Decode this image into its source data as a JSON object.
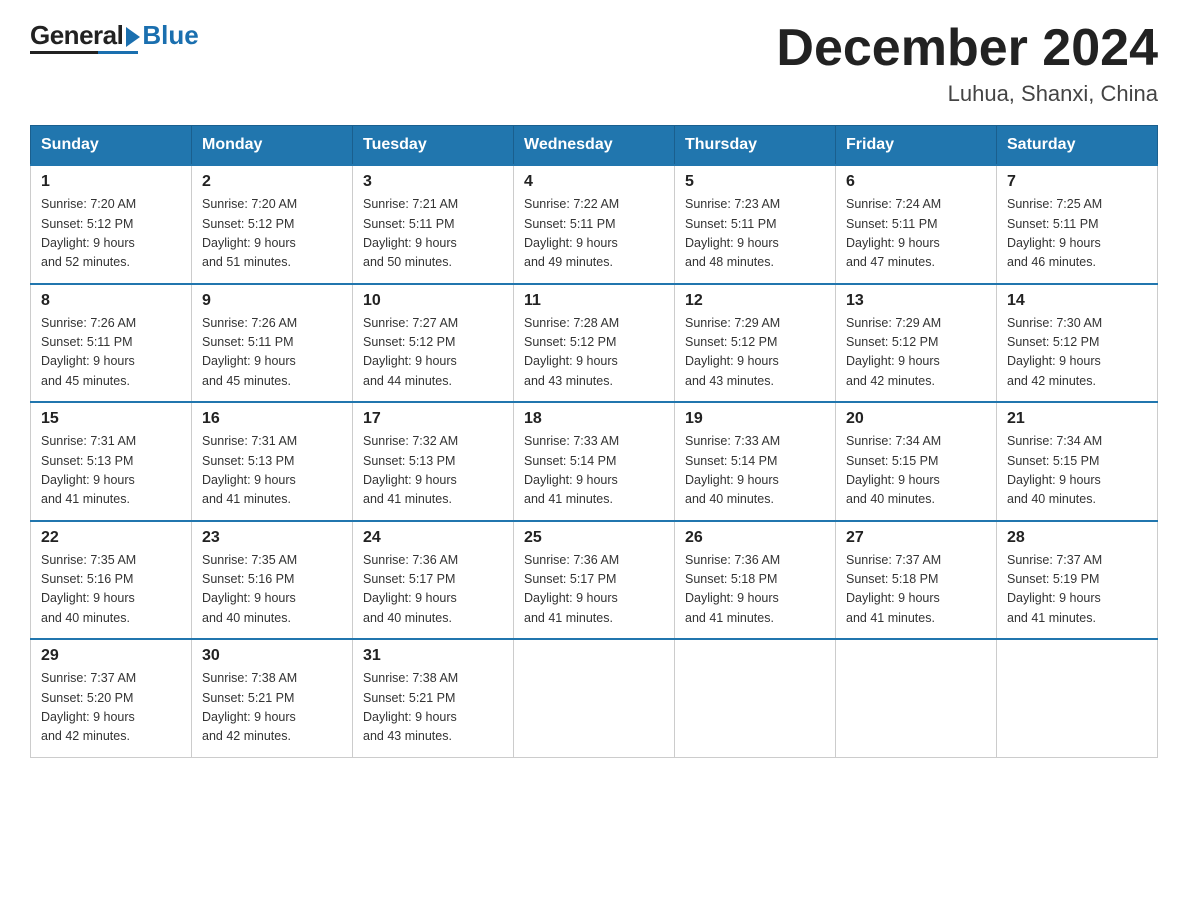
{
  "header": {
    "logo": {
      "general": "General",
      "blue": "Blue"
    },
    "title": "December 2024",
    "location": "Luhua, Shanxi, China"
  },
  "days_of_week": [
    "Sunday",
    "Monday",
    "Tuesday",
    "Wednesday",
    "Thursday",
    "Friday",
    "Saturday"
  ],
  "weeks": [
    [
      {
        "day": "1",
        "sunrise": "7:20 AM",
        "sunset": "5:12 PM",
        "daylight": "9 hours and 52 minutes."
      },
      {
        "day": "2",
        "sunrise": "7:20 AM",
        "sunset": "5:12 PM",
        "daylight": "9 hours and 51 minutes."
      },
      {
        "day": "3",
        "sunrise": "7:21 AM",
        "sunset": "5:11 PM",
        "daylight": "9 hours and 50 minutes."
      },
      {
        "day": "4",
        "sunrise": "7:22 AM",
        "sunset": "5:11 PM",
        "daylight": "9 hours and 49 minutes."
      },
      {
        "day": "5",
        "sunrise": "7:23 AM",
        "sunset": "5:11 PM",
        "daylight": "9 hours and 48 minutes."
      },
      {
        "day": "6",
        "sunrise": "7:24 AM",
        "sunset": "5:11 PM",
        "daylight": "9 hours and 47 minutes."
      },
      {
        "day": "7",
        "sunrise": "7:25 AM",
        "sunset": "5:11 PM",
        "daylight": "9 hours and 46 minutes."
      }
    ],
    [
      {
        "day": "8",
        "sunrise": "7:26 AM",
        "sunset": "5:11 PM",
        "daylight": "9 hours and 45 minutes."
      },
      {
        "day": "9",
        "sunrise": "7:26 AM",
        "sunset": "5:11 PM",
        "daylight": "9 hours and 45 minutes."
      },
      {
        "day": "10",
        "sunrise": "7:27 AM",
        "sunset": "5:12 PM",
        "daylight": "9 hours and 44 minutes."
      },
      {
        "day": "11",
        "sunrise": "7:28 AM",
        "sunset": "5:12 PM",
        "daylight": "9 hours and 43 minutes."
      },
      {
        "day": "12",
        "sunrise": "7:29 AM",
        "sunset": "5:12 PM",
        "daylight": "9 hours and 43 minutes."
      },
      {
        "day": "13",
        "sunrise": "7:29 AM",
        "sunset": "5:12 PM",
        "daylight": "9 hours and 42 minutes."
      },
      {
        "day": "14",
        "sunrise": "7:30 AM",
        "sunset": "5:12 PM",
        "daylight": "9 hours and 42 minutes."
      }
    ],
    [
      {
        "day": "15",
        "sunrise": "7:31 AM",
        "sunset": "5:13 PM",
        "daylight": "9 hours and 41 minutes."
      },
      {
        "day": "16",
        "sunrise": "7:31 AM",
        "sunset": "5:13 PM",
        "daylight": "9 hours and 41 minutes."
      },
      {
        "day": "17",
        "sunrise": "7:32 AM",
        "sunset": "5:13 PM",
        "daylight": "9 hours and 41 minutes."
      },
      {
        "day": "18",
        "sunrise": "7:33 AM",
        "sunset": "5:14 PM",
        "daylight": "9 hours and 41 minutes."
      },
      {
        "day": "19",
        "sunrise": "7:33 AM",
        "sunset": "5:14 PM",
        "daylight": "9 hours and 40 minutes."
      },
      {
        "day": "20",
        "sunrise": "7:34 AM",
        "sunset": "5:15 PM",
        "daylight": "9 hours and 40 minutes."
      },
      {
        "day": "21",
        "sunrise": "7:34 AM",
        "sunset": "5:15 PM",
        "daylight": "9 hours and 40 minutes."
      }
    ],
    [
      {
        "day": "22",
        "sunrise": "7:35 AM",
        "sunset": "5:16 PM",
        "daylight": "9 hours and 40 minutes."
      },
      {
        "day": "23",
        "sunrise": "7:35 AM",
        "sunset": "5:16 PM",
        "daylight": "9 hours and 40 minutes."
      },
      {
        "day": "24",
        "sunrise": "7:36 AM",
        "sunset": "5:17 PM",
        "daylight": "9 hours and 40 minutes."
      },
      {
        "day": "25",
        "sunrise": "7:36 AM",
        "sunset": "5:17 PM",
        "daylight": "9 hours and 41 minutes."
      },
      {
        "day": "26",
        "sunrise": "7:36 AM",
        "sunset": "5:18 PM",
        "daylight": "9 hours and 41 minutes."
      },
      {
        "day": "27",
        "sunrise": "7:37 AM",
        "sunset": "5:18 PM",
        "daylight": "9 hours and 41 minutes."
      },
      {
        "day": "28",
        "sunrise": "7:37 AM",
        "sunset": "5:19 PM",
        "daylight": "9 hours and 41 minutes."
      }
    ],
    [
      {
        "day": "29",
        "sunrise": "7:37 AM",
        "sunset": "5:20 PM",
        "daylight": "9 hours and 42 minutes."
      },
      {
        "day": "30",
        "sunrise": "7:38 AM",
        "sunset": "5:21 PM",
        "daylight": "9 hours and 42 minutes."
      },
      {
        "day": "31",
        "sunrise": "7:38 AM",
        "sunset": "5:21 PM",
        "daylight": "9 hours and 43 minutes."
      },
      null,
      null,
      null,
      null
    ]
  ],
  "labels": {
    "sunrise": "Sunrise:",
    "sunset": "Sunset:",
    "daylight": "Daylight:"
  }
}
